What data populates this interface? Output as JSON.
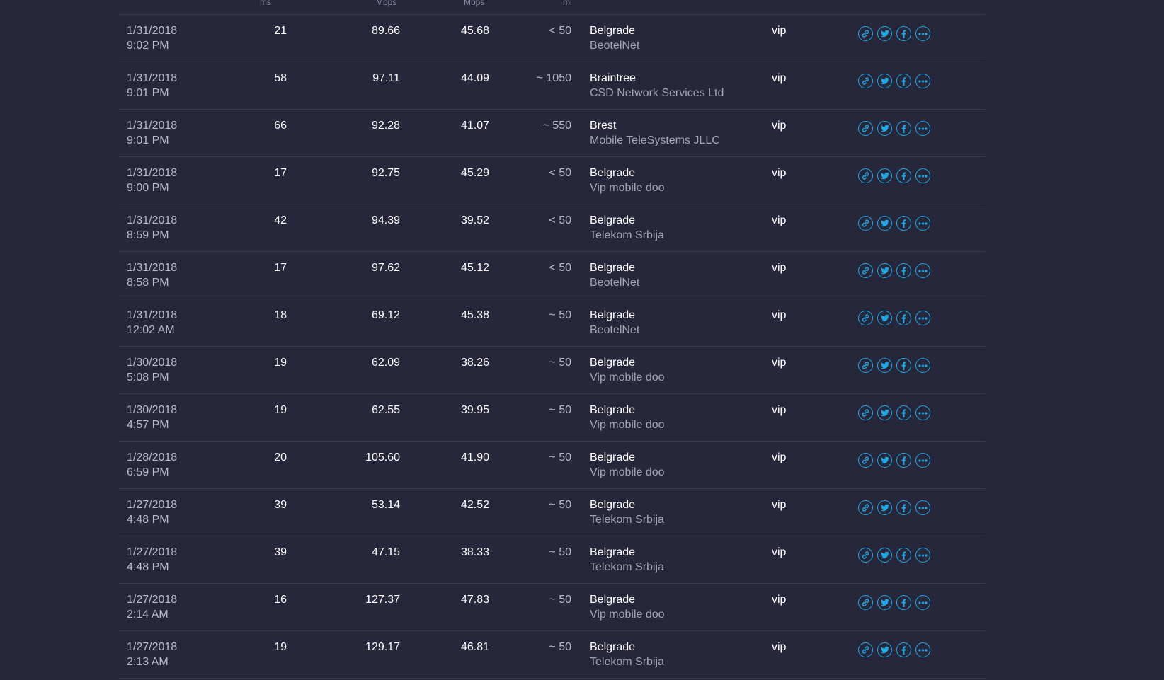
{
  "header_units": {
    "ping": "ms",
    "download": "Mbps",
    "upload": "Mbps",
    "distance": "mi"
  },
  "accent_color": "#1fa8e6",
  "icons": [
    "link-icon",
    "twitter-icon",
    "facebook-icon",
    "more-icon"
  ],
  "rows": [
    {
      "date": "1/31/2018",
      "time": "9:02 PM",
      "ping": "21",
      "download": "89.66",
      "upload": "45.68",
      "distance": "< 50",
      "city": "Belgrade",
      "isp": "BeotelNet",
      "provider": "vip"
    },
    {
      "date": "1/31/2018",
      "time": "9:01 PM",
      "ping": "58",
      "download": "97.11",
      "upload": "44.09",
      "distance": "~ 1050",
      "city": "Braintree",
      "isp": "CSD Network Services Ltd",
      "provider": "vip"
    },
    {
      "date": "1/31/2018",
      "time": "9:01 PM",
      "ping": "66",
      "download": "92.28",
      "upload": "41.07",
      "distance": "~ 550",
      "city": "Brest",
      "isp": "Mobile TeleSystems JLLC",
      "provider": "vip"
    },
    {
      "date": "1/31/2018",
      "time": "9:00 PM",
      "ping": "17",
      "download": "92.75",
      "upload": "45.29",
      "distance": "< 50",
      "city": "Belgrade",
      "isp": "Vip mobile doo",
      "provider": "vip"
    },
    {
      "date": "1/31/2018",
      "time": "8:59 PM",
      "ping": "42",
      "download": "94.39",
      "upload": "39.52",
      "distance": "< 50",
      "city": "Belgrade",
      "isp": "Telekom Srbija",
      "provider": "vip"
    },
    {
      "date": "1/31/2018",
      "time": "8:58 PM",
      "ping": "17",
      "download": "97.62",
      "upload": "45.12",
      "distance": "< 50",
      "city": "Belgrade",
      "isp": "BeotelNet",
      "provider": "vip"
    },
    {
      "date": "1/31/2018",
      "time": "12:02 AM",
      "ping": "18",
      "download": "69.12",
      "upload": "45.38",
      "distance": "~ 50",
      "city": "Belgrade",
      "isp": "BeotelNet",
      "provider": "vip"
    },
    {
      "date": "1/30/2018",
      "time": "5:08 PM",
      "ping": "19",
      "download": "62.09",
      "upload": "38.26",
      "distance": "~ 50",
      "city": "Belgrade",
      "isp": "Vip mobile doo",
      "provider": "vip"
    },
    {
      "date": "1/30/2018",
      "time": "4:57 PM",
      "ping": "19",
      "download": "62.55",
      "upload": "39.95",
      "distance": "~ 50",
      "city": "Belgrade",
      "isp": "Vip mobile doo",
      "provider": "vip"
    },
    {
      "date": "1/28/2018",
      "time": "6:59 PM",
      "ping": "20",
      "download": "105.60",
      "upload": "41.90",
      "distance": "~ 50",
      "city": "Belgrade",
      "isp": "Vip mobile doo",
      "provider": "vip"
    },
    {
      "date": "1/27/2018",
      "time": "4:48 PM",
      "ping": "39",
      "download": "53.14",
      "upload": "42.52",
      "distance": "~ 50",
      "city": "Belgrade",
      "isp": "Telekom Srbija",
      "provider": "vip"
    },
    {
      "date": "1/27/2018",
      "time": "4:48 PM",
      "ping": "39",
      "download": "47.15",
      "upload": "38.33",
      "distance": "~ 50",
      "city": "Belgrade",
      "isp": "Telekom Srbija",
      "provider": "vip"
    },
    {
      "date": "1/27/2018",
      "time": "2:14 AM",
      "ping": "16",
      "download": "127.37",
      "upload": "47.83",
      "distance": "~ 50",
      "city": "Belgrade",
      "isp": "Vip mobile doo",
      "provider": "vip"
    },
    {
      "date": "1/27/2018",
      "time": "2:13 AM",
      "ping": "19",
      "download": "129.17",
      "upload": "46.81",
      "distance": "~ 50",
      "city": "Belgrade",
      "isp": "Telekom Srbija",
      "provider": "vip"
    }
  ]
}
